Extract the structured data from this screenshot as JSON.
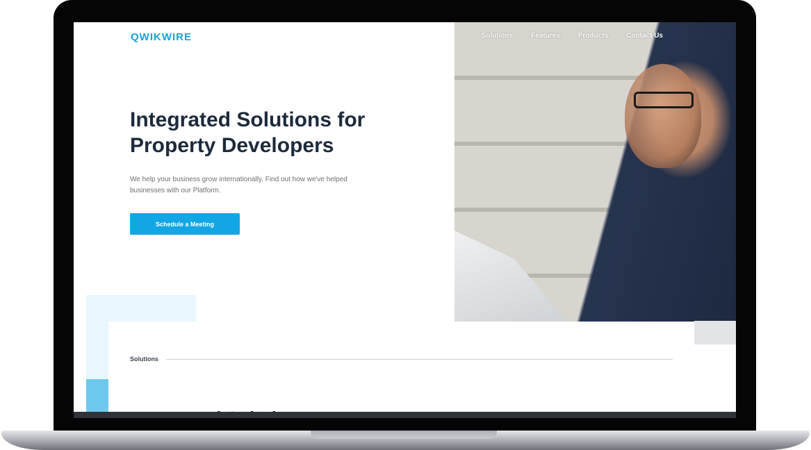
{
  "brand": {
    "logo_text": "QWIKWIRE",
    "accent_color": "#12a6e4"
  },
  "nav": {
    "items": [
      "Solutions",
      "Features",
      "Products",
      "Contact Us"
    ]
  },
  "hero": {
    "title": "Integrated Solutions for Property Developers",
    "subtitle": "We help your business grow internationally. Find out how we've helped businesses with our Platform.",
    "cta_label": "Schedule a Meeting"
  },
  "section": {
    "label": "Solutions",
    "heading_partial": "Next-Level Solutions"
  },
  "images": {
    "hero_photo": "businessman-smiling-photo"
  }
}
